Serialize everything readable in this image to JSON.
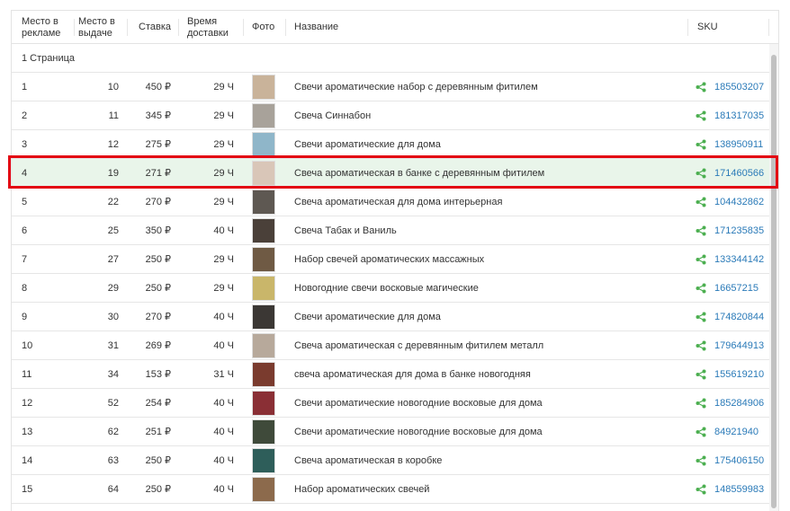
{
  "header": {
    "ad_position": "Место в рекламе",
    "position": "Место в выдаче",
    "bid": "Ставка",
    "delivery_time": "Время доставки",
    "photo": "Фото",
    "name": "Название",
    "sku": "SKU"
  },
  "group_label": "1 Страница",
  "rows": [
    {
      "ad": "1",
      "pos": "10",
      "bid": "450 ₽",
      "time": "29 Ч",
      "name": "Свечи ароматические набор с деревянным фитилем",
      "sku": "185503207",
      "thumb": "#c9b39a"
    },
    {
      "ad": "2",
      "pos": "11",
      "bid": "345 ₽",
      "time": "29 Ч",
      "name": "Свеча Синнабон",
      "sku": "181317035",
      "thumb": "#a8a29a"
    },
    {
      "ad": "3",
      "pos": "12",
      "bid": "275 ₽",
      "time": "29 Ч",
      "name": "Свечи ароматические для дома",
      "sku": "138950911",
      "thumb": "#8fb6c9"
    },
    {
      "ad": "4",
      "pos": "19",
      "bid": "271 ₽",
      "time": "29 Ч",
      "name": "Свеча ароматическая в банке с деревянным фитилем",
      "sku": "171460566",
      "thumb": "#d9c6b8"
    },
    {
      "ad": "5",
      "pos": "22",
      "bid": "270 ₽",
      "time": "29 Ч",
      "name": "Свеча ароматическая для дома интерьерная",
      "sku": "104432862",
      "thumb": "#5e5852"
    },
    {
      "ad": "6",
      "pos": "25",
      "bid": "350 ₽",
      "time": "40 Ч",
      "name": "Свеча Табак и Ваниль",
      "sku": "171235835",
      "thumb": "#4a4039"
    },
    {
      "ad": "7",
      "pos": "27",
      "bid": "250 ₽",
      "time": "29 Ч",
      "name": "Набор свечей ароматических массажных",
      "sku": "133344142",
      "thumb": "#6f5a44"
    },
    {
      "ad": "8",
      "pos": "29",
      "bid": "250 ₽",
      "time": "29 Ч",
      "name": "Новогодние свечи восковые магические",
      "sku": "16657215",
      "thumb": "#c9b66a"
    },
    {
      "ad": "9",
      "pos": "30",
      "bid": "270 ₽",
      "time": "40 Ч",
      "name": "Свечи ароматические для дома",
      "sku": "174820844",
      "thumb": "#3b3734"
    },
    {
      "ad": "10",
      "pos": "31",
      "bid": "269 ₽",
      "time": "40 Ч",
      "name": "Свеча ароматическая с деревянным фитилем металл",
      "sku": "179644913",
      "thumb": "#b7a99b"
    },
    {
      "ad": "11",
      "pos": "34",
      "bid": "153 ₽",
      "time": "31 Ч",
      "name": "свеча ароматическая для дома в банке новогодняя",
      "sku": "155619210",
      "thumb": "#7a3b2e"
    },
    {
      "ad": "12",
      "pos": "52",
      "bid": "254 ₽",
      "time": "40 Ч",
      "name": "Свечи ароматические новогодние восковые для дома",
      "sku": "185284906",
      "thumb": "#8a2f35"
    },
    {
      "ad": "13",
      "pos": "62",
      "bid": "251 ₽",
      "time": "40 Ч",
      "name": "Свечи ароматические новогодние восковые для дома",
      "sku": "84921940",
      "thumb": "#3f4a3a"
    },
    {
      "ad": "14",
      "pos": "63",
      "bid": "250 ₽",
      "time": "40 Ч",
      "name": "Свеча ароматическая в коробке",
      "sku": "175406150",
      "thumb": "#2e5e5a"
    },
    {
      "ad": "15",
      "pos": "64",
      "bid": "250 ₽",
      "time": "40 Ч",
      "name": "Набор ароматических свечей",
      "sku": "148559983",
      "thumb": "#8c6a4c"
    }
  ],
  "highlighted_row_index": 3,
  "colors": {
    "highlight_bg": "#e9f5ea",
    "highlight_border": "#e30613",
    "link": "#2a7ab8",
    "share_icon": "#4caf50"
  },
  "icons": {
    "sku_icon": "share-icon",
    "photo": "product-thumbnail"
  }
}
